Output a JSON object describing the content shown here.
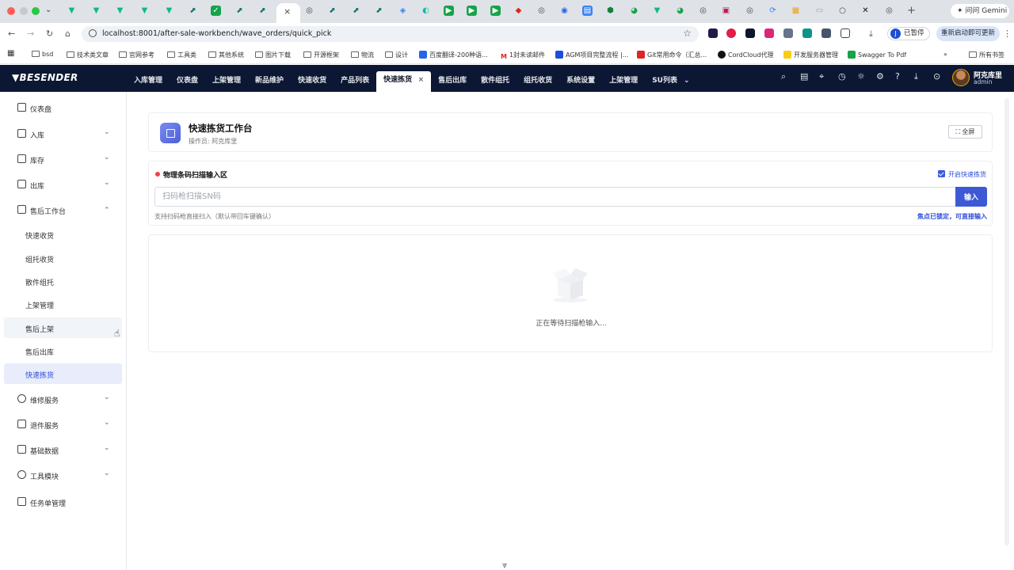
{
  "browser": {
    "url": "localhost:8001/after-sale-workbench/wave_orders/quick_pick",
    "gemini_label": "问问 Gemini",
    "paused_avatar": "J",
    "paused_label": "已暂停",
    "restart_label": "重新启动即可更新",
    "bookmarks": [
      "bsd",
      "技术类文章",
      "官网参考",
      "工具类",
      "其他系统",
      "图片下载",
      "开源框架",
      "物流",
      "设计",
      "百度翻译-200种语...",
      "1封未读邮件",
      "AGM项目完整流程 |...",
      "Git常用命令（汇总...",
      "CordCloud代理",
      "开发服务器管理",
      "Swagger To Pdf",
      "所有书签"
    ]
  },
  "app": {
    "logo": "BESENDER",
    "top_nav": [
      "入库管理",
      "仪表盘",
      "上架管理",
      "新品维护",
      "快速收货",
      "产品列表",
      "快速拣货",
      "售后出库",
      "散件组托",
      "组托收货",
      "系统设置",
      "上架管理",
      "SU列表"
    ],
    "user": {
      "name": "阿克库里",
      "role": "admin"
    },
    "colors": {
      "header_bg": "#0b1733",
      "accent": "#3e59d6",
      "active_bg": "#e8ecfb"
    }
  },
  "sidebar": {
    "items": [
      {
        "label": "仪表盘",
        "icon": "home-icon"
      },
      {
        "label": "入库",
        "icon": "inbound-icon"
      },
      {
        "label": "库存",
        "icon": "stock-icon"
      },
      {
        "label": "出库",
        "icon": "outbound-icon"
      },
      {
        "label": "售后工作台",
        "icon": "workbench-icon"
      },
      {
        "label": "维修服务",
        "icon": "wrench-icon"
      },
      {
        "label": "退件服务",
        "icon": "return-icon"
      },
      {
        "label": "基础数据",
        "icon": "data-icon"
      },
      {
        "label": "工具模块",
        "icon": "tools-icon"
      },
      {
        "label": "任务单管理",
        "icon": "task-icon"
      }
    ],
    "sub_items": [
      "快速收货",
      "组托收货",
      "散件组托",
      "上架管理",
      "售后上架",
      "售后出库",
      "快速拣货"
    ]
  },
  "page": {
    "title": "快速拣货工作台",
    "operator": "操作员: 阿克库里",
    "fullscreen_label": "全屏",
    "scan": {
      "title": "物理条码扫描输入区",
      "quick_label": "开启快速拣货",
      "quick_checked": true,
      "placeholder": "扫码枪扫描SN码",
      "value": "",
      "enter_label": "输入",
      "hint": "支持扫码枪直接扫入（默认带回车键确认）",
      "focus_status": "焦点已锁定，可直接输入"
    },
    "empty_text": "正在等待扫描枪输入..."
  }
}
